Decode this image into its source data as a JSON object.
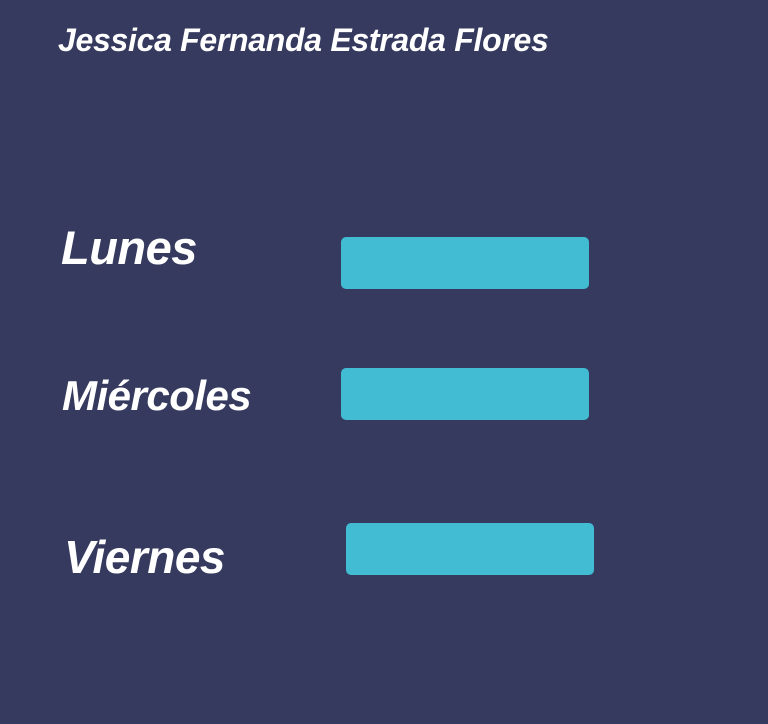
{
  "header": {
    "title": "Jessica Fernanda Estrada Flores"
  },
  "colors": {
    "background": "#353a5e",
    "text": "#ffffff",
    "button": "#41bcd3"
  },
  "schedule": {
    "days": [
      {
        "label": "Lunes",
        "button_text": ""
      },
      {
        "label": "Miércoles",
        "button_text": ""
      },
      {
        "label": "Viernes",
        "button_text": ""
      }
    ]
  }
}
